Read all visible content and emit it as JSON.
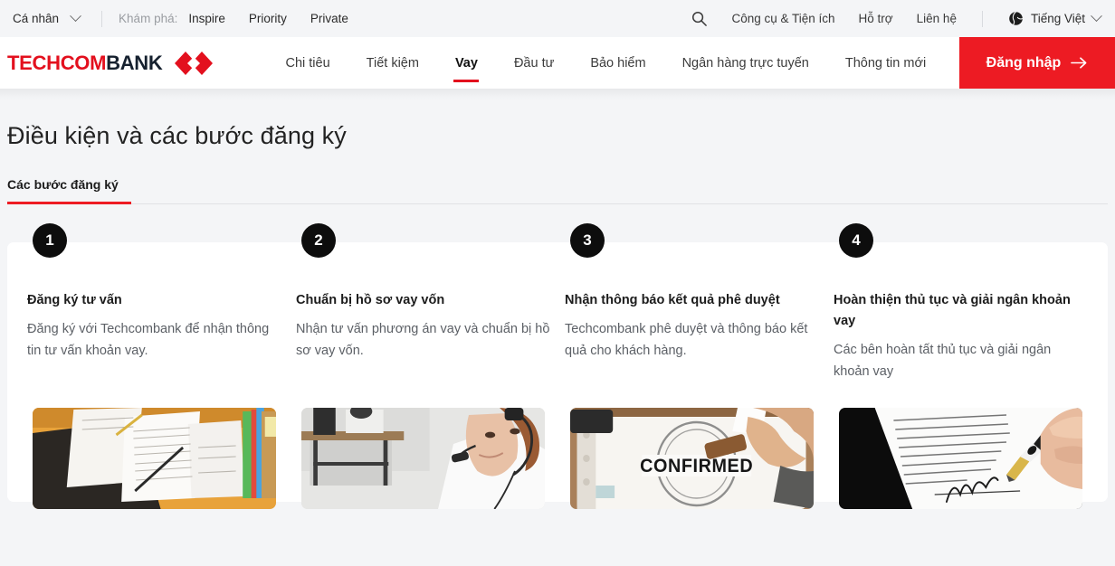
{
  "utility_bar": {
    "persona": "Cá nhân",
    "persona_chevron_icon": "chevron-down-icon",
    "explore_label": "Khám phá:",
    "explore_links": [
      "Inspire",
      "Priority",
      "Private"
    ],
    "search_icon": "search-icon",
    "links": [
      "Công cụ & Tiện ích",
      "Hỗ trợ",
      "Liên hệ"
    ],
    "language": "Tiếng Việt",
    "language_icon": "globe-icon",
    "language_chevron_icon": "chevron-down-icon"
  },
  "main_nav": {
    "logo_part1": "TECHCOM",
    "logo_part2": "BANK",
    "logo_mark_icon": "techcombank-diamonds-icon",
    "links": [
      {
        "label": "Chi tiêu",
        "active": false
      },
      {
        "label": "Tiết kiệm",
        "active": false
      },
      {
        "label": "Vay",
        "active": true
      },
      {
        "label": "Đầu tư",
        "active": false
      },
      {
        "label": "Bảo hiểm",
        "active": false
      },
      {
        "label": "Ngân hàng trực tuyến",
        "active": false
      },
      {
        "label": "Thông tin mới",
        "active": false
      }
    ],
    "login_label": "Đăng nhập",
    "login_arrow_icon": "arrow-right-icon"
  },
  "page": {
    "title": "Điều kiện và các bước đăng ký",
    "tab_label": "Các bước đăng ký"
  },
  "steps": [
    {
      "number": "1",
      "title": "Đăng ký tư vấn",
      "desc": "Đăng ký với Techcombank để nhận thông tin tư vấn khoản vay.",
      "image_name": "documents-on-desk-photo"
    },
    {
      "number": "2",
      "title": "Chuẩn bị hồ sơ vay vốn",
      "desc": "Nhận tư vấn phương án vay và chuẩn bị hồ sơ vay vốn.",
      "image_name": "call-center-agent-photo"
    },
    {
      "number": "3",
      "title": "Nhận thông báo kết quả phê duyệt",
      "desc": "Techcombank phê duyệt và thông báo kết quả cho khách hàng.",
      "image_name": "confirmed-stamp-photo",
      "image_text": "CONFIRMED"
    },
    {
      "number": "4",
      "title": "Hoàn thiện thủ tục và giải ngân khoản vay",
      "desc": "Các bên hoàn tất thủ tục và giải ngân khoản vay",
      "image_name": "signing-contract-photo"
    }
  ],
  "colors": {
    "brand_red": "#ed1b23",
    "logo_red": "#e3101e",
    "logo_navy": "#16212f",
    "page_bg": "#f4f5f7",
    "card_bg": "#ffffff",
    "badge_bg": "#0d0d0d"
  }
}
